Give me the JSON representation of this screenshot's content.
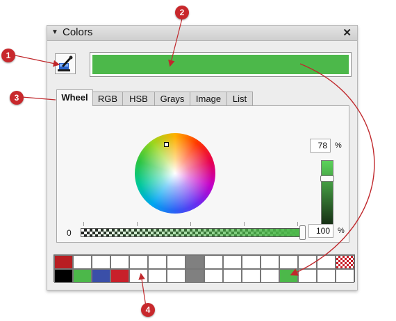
{
  "panel": {
    "title": "Colors",
    "collapse_arrow": "▼",
    "close_label": "✕",
    "current_color": "#4cb84a"
  },
  "tabs": [
    {
      "label": "Wheel",
      "active": true
    },
    {
      "label": "RGB",
      "active": false
    },
    {
      "label": "HSB",
      "active": false
    },
    {
      "label": "Grays",
      "active": false
    },
    {
      "label": "Image",
      "active": false
    },
    {
      "label": "List",
      "active": false
    }
  ],
  "wheel_tab": {
    "brightness_value": "78",
    "brightness_unit": "%",
    "opacity_min_label": "0",
    "opacity_value": "100",
    "opacity_unit": "%"
  },
  "palette": {
    "row1": [
      "#b81e22",
      "#ffffff",
      "#ffffff",
      "#ffffff",
      "#ffffff",
      "#ffffff",
      "#ffffff",
      "#808080",
      "#ffffff",
      "#ffffff",
      "#ffffff",
      "#ffffff",
      "#ffffff",
      "#ffffff",
      "#ffffff",
      "checker"
    ],
    "row2": [
      "#000000",
      "#4cb84a",
      "#3a4fa8",
      "#c8202a",
      "#ffffff",
      "#ffffff",
      "#ffffff",
      "#808080",
      "#ffffff",
      "#ffffff",
      "#ffffff",
      "#ffffff",
      "#4cb84a",
      "#ffffff",
      "#ffffff",
      "#ffffff"
    ]
  },
  "callouts": [
    "1",
    "2",
    "3",
    "4"
  ],
  "colors": {
    "callout_red": "#c8282c",
    "arrow_red": "#c0282c"
  }
}
